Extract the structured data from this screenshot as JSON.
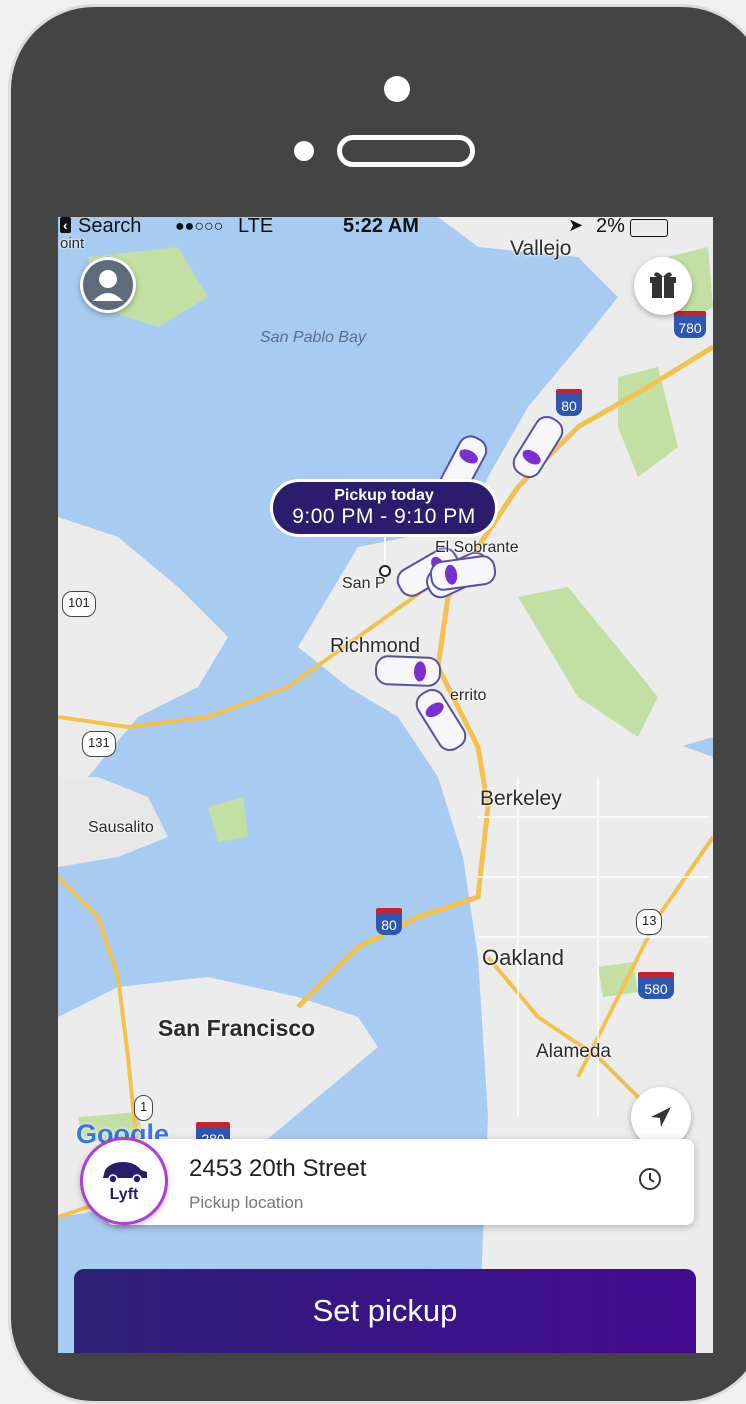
{
  "status_bar": {
    "back_label": "Search",
    "signal": "●●○○○",
    "network": "LTE",
    "time": "5:22 AM",
    "battery": "2%"
  },
  "map": {
    "places": {
      "vallejo": "Vallejo",
      "san_pablo_bay": "San Pablo Bay",
      "el_sobrante": "El Sobrante",
      "san_pablo_partial": "San P",
      "richmond": "Richmond",
      "el_cerrito_partial": "errito",
      "berkeley": "Berkeley",
      "sausalito": "Sausalito",
      "oakland": "Oakland",
      "san_francisco": "San Francisco",
      "alameda": "Alameda",
      "point_partial": "oint"
    },
    "shields": {
      "i780": "780",
      "i80_north": "80",
      "i80_bay": "80",
      "i580": "580",
      "i280": "280",
      "hw101": "101",
      "hw131": "131",
      "hw13": "13",
      "hw1": "1"
    },
    "attribution": "Google"
  },
  "pickup_tooltip": {
    "line1": "Pickup today",
    "line2": "9:00 PM - 9:10 PM"
  },
  "location_card": {
    "address": "2453 20th Street",
    "subtitle": "Pickup location"
  },
  "ride_type": {
    "label": "Lyft"
  },
  "primary_button": {
    "label": "Set pickup"
  },
  "colors": {
    "brand_purple": "#2c1c6e",
    "lyft_pink": "#b03dd4",
    "water": "#a8cbf2",
    "land": "#ececec",
    "park": "#c2e0a3",
    "highway": "#f4c24c"
  },
  "icons": {
    "profile": "person-silhouette-icon",
    "gift": "gift-icon",
    "locate": "location-arrow-icon",
    "schedule": "clock-icon",
    "car": "car-icon"
  }
}
